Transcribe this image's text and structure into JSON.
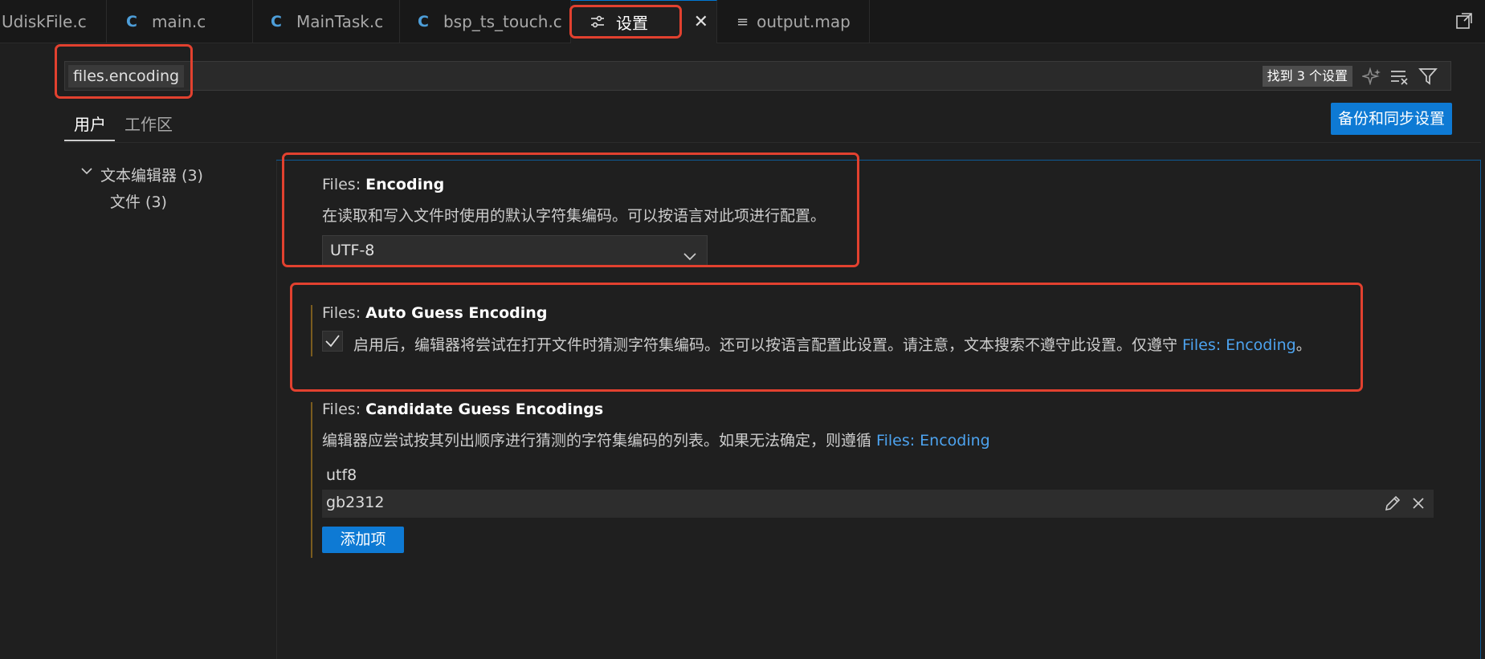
{
  "tabs": [
    {
      "label": "UdiskFile.c",
      "icon": "c-file-icon",
      "icon_glyph": ""
    },
    {
      "label": "main.c",
      "icon": "c-file-icon",
      "icon_glyph": "C"
    },
    {
      "label": "MainTask.c",
      "icon": "c-file-icon",
      "icon_glyph": "C"
    },
    {
      "label": "bsp_ts_touch.c",
      "icon": "c-file-icon",
      "icon_glyph": "C"
    },
    {
      "label": "设置",
      "icon": "settings-sliders-icon",
      "active": true
    },
    {
      "label": "output.map",
      "icon": "text-file-icon"
    }
  ],
  "search": {
    "value": "files.encoding",
    "result_badge": "找到 3 个设置"
  },
  "scope_tabs": [
    {
      "label": "用户",
      "active": true
    },
    {
      "label": "工作区",
      "active": false
    }
  ],
  "sync_button_label": "备份和同步设置",
  "tree": {
    "group_label": "文本编辑器 (3)",
    "child_label": "文件 (3)"
  },
  "settings": {
    "encoding": {
      "category": "Files: ",
      "name": "Encoding",
      "description": "在读取和写入文件时使用的默认字符集编码。可以按语言对此项进行配置。",
      "selected_value": "UTF-8"
    },
    "auto_guess": {
      "category": "Files: ",
      "name": "Auto Guess Encoding",
      "description": "启用后，编辑器将尝试在打开文件时猜测字符集编码。还可以按语言配置此设置。请注意，文本搜索不遵守此设置。仅遵守 ",
      "link": "Files: Encoding",
      "suffix": "。",
      "checked": true
    },
    "candidate": {
      "category": "Files: ",
      "name": "Candidate Guess Encodings",
      "description": "编辑器应尝试按其列出顺序进行猜测的字符集编码的列表。如果无法确定，则遵循 ",
      "link": "Files: Encoding",
      "items": [
        "utf8",
        "gb2312"
      ],
      "add_label": "添加项"
    }
  },
  "colors": {
    "accent": "#0e7ad4",
    "link": "#4da3ef",
    "annotation": "#e2412f",
    "modified_bar": "#7a5b1e"
  }
}
